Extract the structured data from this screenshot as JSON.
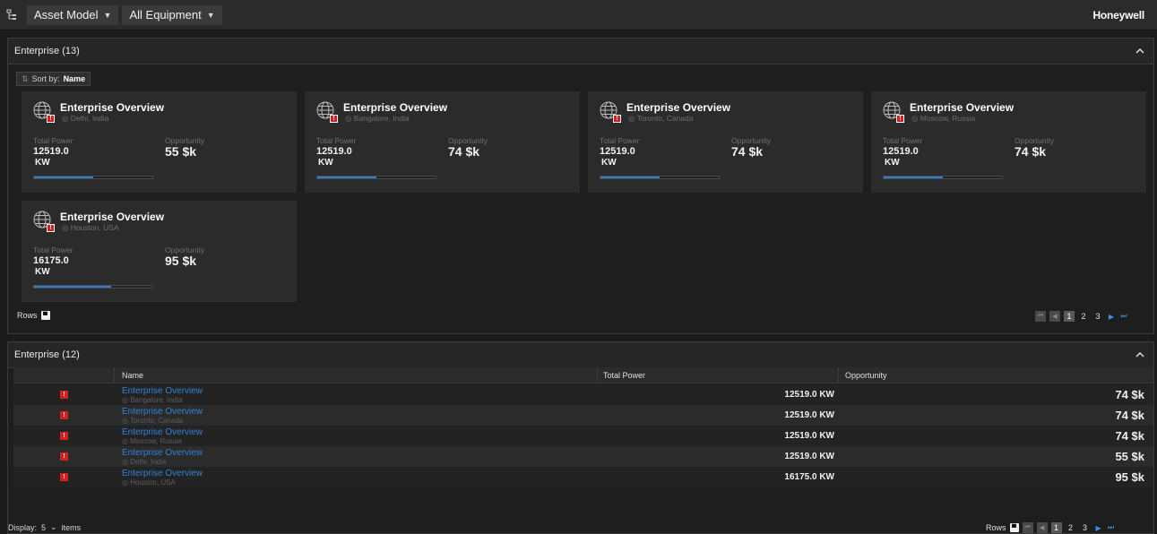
{
  "topbar": {
    "asset_model_label": "Asset Model",
    "equipment_label": "All Equipment",
    "brand": "Honeywell"
  },
  "panel1": {
    "title": "Enterprise (13)",
    "sort_prefix": "Sort by:",
    "sort_value": "Name",
    "rows_label": "Rows",
    "pages": [
      "1",
      "2",
      "3"
    ],
    "active_page": "1"
  },
  "cards": [
    {
      "title": "Enterprise Overview",
      "location": "Delhi, India",
      "total_power_label": "Total Power",
      "total_power": "12519.0",
      "unit": "KW",
      "opportunity_label": "Opportunity",
      "opportunity": "55 $k",
      "progress": 0.5
    },
    {
      "title": "Enterprise Overview",
      "location": "Bangalore, India",
      "total_power_label": "Total Power",
      "total_power": "12519.0",
      "unit": "KW",
      "opportunity_label": "Opportunity",
      "opportunity": "74 $k",
      "progress": 0.5
    },
    {
      "title": "Enterprise Overview",
      "location": "Toronto, Canada",
      "total_power_label": "Total Power",
      "total_power": "12519.0",
      "unit": "KW",
      "opportunity_label": "Opportunity",
      "opportunity": "74 $k",
      "progress": 0.5
    },
    {
      "title": "Enterprise Overview",
      "location": "Moscow, Russia",
      "total_power_label": "Total Power",
      "total_power": "12519.0",
      "unit": "KW",
      "opportunity_label": "Opportunity",
      "opportunity": "74 $k",
      "progress": 0.5
    },
    {
      "title": "Enterprise Overview",
      "location": "Houston, USA",
      "total_power_label": "Total Power",
      "total_power": "16175.0",
      "unit": "KW",
      "opportunity_label": "Opportunity",
      "opportunity": "95 $k",
      "progress": 0.65
    }
  ],
  "panel2": {
    "title": "Enterprise (12)",
    "columns": {
      "name": "Name",
      "total_power": "Total Power",
      "opportunity": "Opportunity"
    },
    "rows": [
      {
        "name": "Enterprise Overview",
        "location": "Bangalore, India",
        "total_power": "12519.0 KW",
        "opportunity": "74 $k"
      },
      {
        "name": "Enterprise Overview",
        "location": "Toronto, Canada",
        "total_power": "12519.0 KW",
        "opportunity": "74 $k"
      },
      {
        "name": "Enterprise Overview",
        "location": "Moscow, Russia",
        "total_power": "12519.0 KW",
        "opportunity": "74 $k"
      },
      {
        "name": "Enterprise Overview",
        "location": "Delhi, India",
        "total_power": "12519.0 KW",
        "opportunity": "55 $k"
      },
      {
        "name": "Enterprise Overview",
        "location": "Houston, USA",
        "total_power": "16175.0 KW",
        "opportunity": "95 $k"
      }
    ],
    "display_label": "Display:",
    "display_value": "5",
    "display_suffix": "items",
    "rows_label": "Rows",
    "pages": [
      "1",
      "2",
      "3"
    ],
    "active_page": "1"
  },
  "colors": {
    "accent": "#2f7fd1",
    "alert": "#d81f1f",
    "link": "#2f82d6"
  },
  "icons": {
    "tree": "tree-icon",
    "globe": "globe-icon",
    "alert": "alert-icon",
    "pin": "location-pin-icon",
    "lock": "lock-icon",
    "collapse": "chevron-up-icon"
  }
}
